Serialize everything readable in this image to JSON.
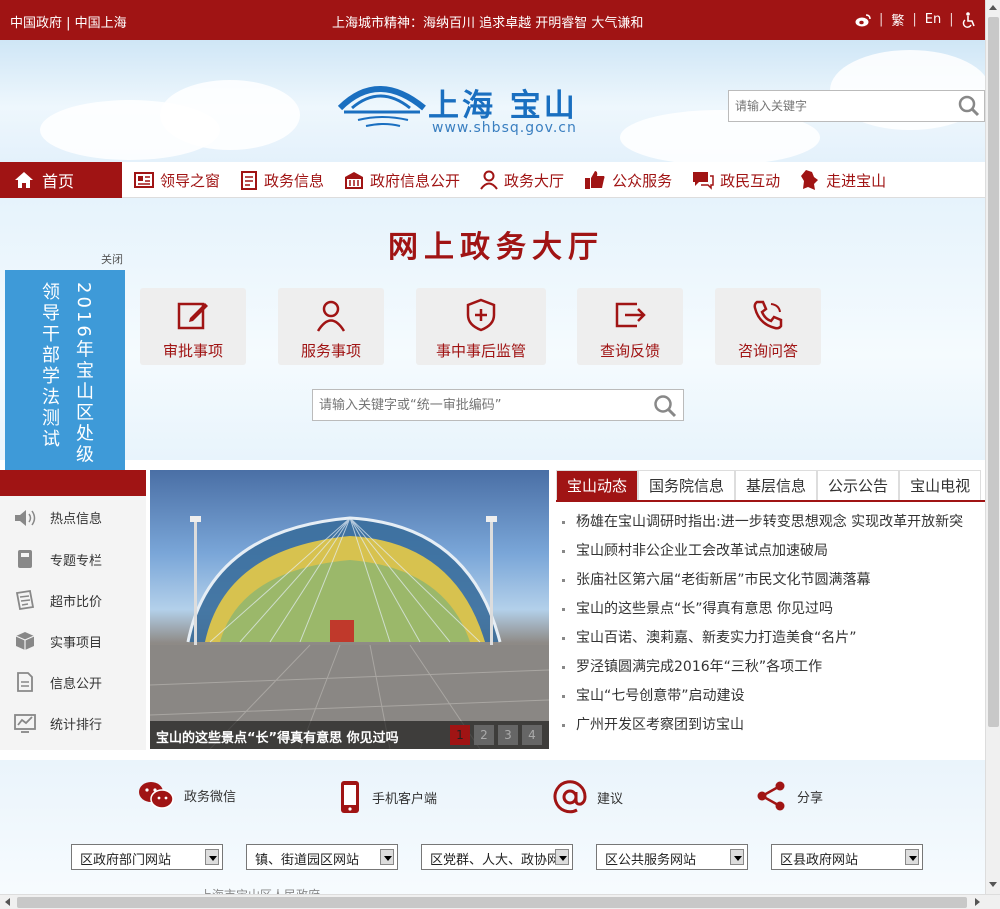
{
  "topbar": {
    "left": "中国政府 | 中国上海",
    "center": "上海城市精神：海纳百川 追求卓越 开明睿智 大气谦和",
    "trad": "繁",
    "en": "En"
  },
  "header": {
    "logo_text": "上海 宝山",
    "logo_url": "www.shbsq.gov.cn",
    "search_placeholder": "请输入关键字"
  },
  "nav": {
    "home": "首页",
    "items": [
      "领导之窗",
      "政务信息",
      "政府信息公开",
      "政务大厅",
      "公众服务",
      "政民互动",
      "走进宝山"
    ]
  },
  "hall": {
    "title": "网上政务大厅",
    "tiles": [
      "审批事项",
      "服务事项",
      "事中事后监管",
      "查询反馈",
      "咨询问答"
    ],
    "search_placeholder": "请输入关键字或“统一审批编码”"
  },
  "float_banner": {
    "close": "关闭",
    "col1": "2016年宝山区处级",
    "col2": "领导干部学法测试"
  },
  "sidebar": {
    "items": [
      "热点信息",
      "专题专栏",
      "超市比价",
      "实事项目",
      "信息公开",
      "统计排行"
    ]
  },
  "slider": {
    "caption": "宝山的这些景点“长”得真有意思 你见过吗",
    "pages": [
      "1",
      "2",
      "3",
      "4"
    ],
    "active": 1
  },
  "news": {
    "tabs": [
      "宝山动态",
      "国务院信息",
      "基层信息",
      "公示公告",
      "宝山电视"
    ],
    "items": [
      "杨雄在宝山调研时指出:进一步转变思想观念 实现改革开放新突",
      "宝山顾村非公企业工会改革试点加速破局",
      "张庙社区第六届“老街新居”市民文化节圆满落幕",
      "宝山的这些景点“长”得真有意思 你见过吗",
      "宝山百诺、澳莉嘉、新麦实力打造美食“名片”",
      "罗泾镇圆满完成2016年“三秋”各项工作",
      "宝山“七号创意带”启动建设",
      "广州开发区考察团到访宝山"
    ]
  },
  "footer": {
    "share": [
      "政务微信",
      "手机客户端",
      "建议",
      "分享"
    ],
    "selects": [
      "区政府部门网站",
      "镇、街道园区网站",
      "区党群、人大、政协网",
      "区公共服务网站",
      "区县政府网站"
    ],
    "bottom_text": "上海市宝山区人民政府"
  },
  "colors": {
    "brand": "#a01414",
    "accent": "#1a6fc0",
    "float": "#3e9ad8"
  }
}
